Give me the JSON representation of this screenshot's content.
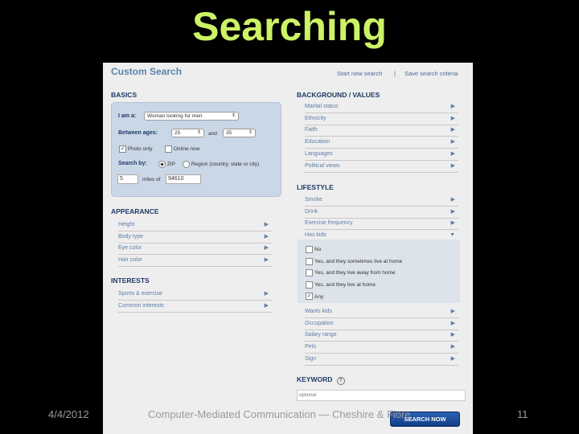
{
  "slide": {
    "title": "Searching",
    "date": "4/4/2012",
    "footer": "Computer-Mediated Communication — Cheshire & Fiore",
    "page": "11"
  },
  "panel": {
    "title": "Custom Search",
    "start_new": "Start new search",
    "separator": "|",
    "save": "Save search criteria"
  },
  "basics": {
    "heading": "BASICS",
    "iam_label": "I am a:",
    "iam_value": "Woman looking for men",
    "ages_label": "Between ages:",
    "age_min": "25",
    "and_label": "and",
    "age_max": "35",
    "photo_only": "Photo only",
    "photo_checked": true,
    "online_now": "Online now",
    "online_checked": false,
    "searchby_label": "Search by:",
    "zip_label": "ZIP",
    "zip_selected": true,
    "region_label": "Region (country, state or city)",
    "miles_value": "5",
    "miles_label": "miles of",
    "zip_value": "94610"
  },
  "appearance": {
    "heading": "APPEARANCE",
    "items": [
      "Height",
      "Body type",
      "Eye color",
      "Hair color"
    ]
  },
  "interests": {
    "heading": "INTERESTS",
    "items": [
      "Sports & exercise",
      "Common interests"
    ]
  },
  "background": {
    "heading": "BACKGROUND / VALUES",
    "items": [
      "Marital status",
      "Ethnicity",
      "Faith",
      "Education",
      "Languages",
      "Political views"
    ]
  },
  "lifestyle": {
    "heading": "LIFESTYLE",
    "items_top": [
      "Smoke",
      "Drink",
      "Exercise frequency",
      "Has kids"
    ],
    "has_kids_options": [
      {
        "label": "No",
        "checked": false
      },
      {
        "label": "Yes, and they sometimes live at home",
        "checked": false
      },
      {
        "label": "Yes, and they live away from home",
        "checked": false
      },
      {
        "label": "Yes, and they live at home",
        "checked": false
      },
      {
        "label": "Any",
        "checked": true
      }
    ],
    "items_bottom": [
      "Wants kids",
      "Occupation",
      "Salary range",
      "Pets",
      "Sign"
    ]
  },
  "keyword": {
    "heading": "KEYWORD",
    "help": "?",
    "placeholder": "optional"
  },
  "search_button": "SEARCH NOW"
}
